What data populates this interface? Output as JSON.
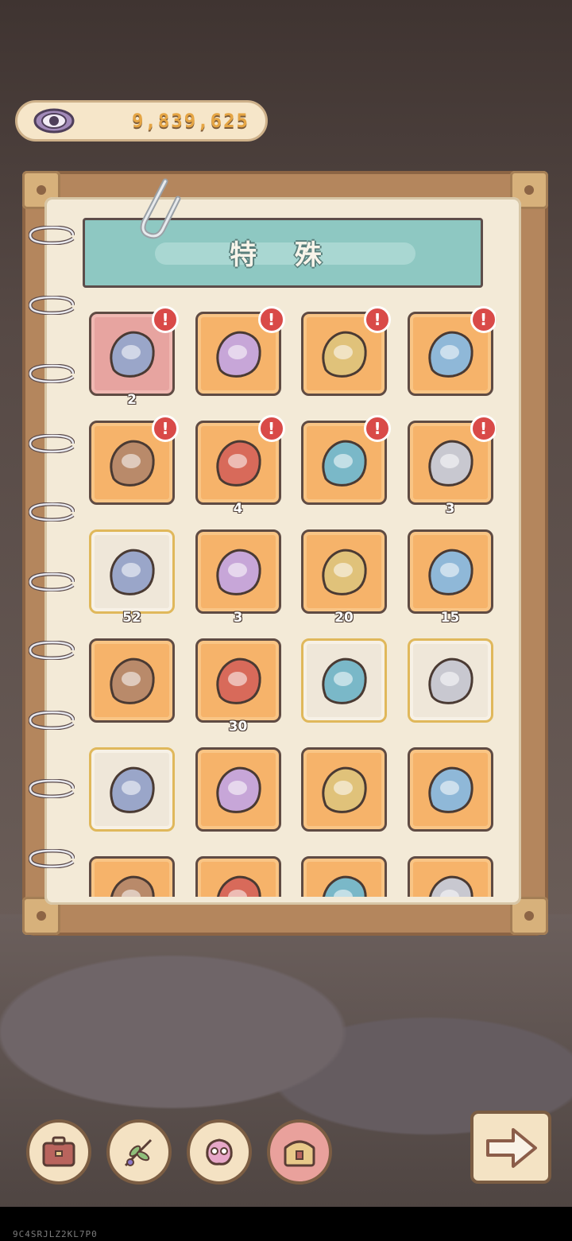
{
  "currency": {
    "icon": "eye-icon",
    "value": "9,839,625"
  },
  "page": {
    "title": "特 殊"
  },
  "items": [
    {
      "icon": "gem-pouch-icon",
      "style": "pink",
      "count": "2",
      "badge": true
    },
    {
      "icon": "gift-box-icon",
      "style": "orange",
      "count": "",
      "badge": true
    },
    {
      "icon": "treasure-chest-icon",
      "style": "orange",
      "count": "",
      "badge": true
    },
    {
      "icon": "ornate-pouch-icon",
      "style": "orange",
      "count": "",
      "badge": true
    },
    {
      "icon": "chest-level-1-icon",
      "style": "orange",
      "count": "",
      "badge": true
    },
    {
      "icon": "chest-level-2-icon",
      "style": "orange",
      "count": "4",
      "badge": true
    },
    {
      "icon": "specimen-jar-icon",
      "style": "orange",
      "count": "",
      "badge": true
    },
    {
      "icon": "fossil-stone-icon",
      "style": "orange",
      "count": "3",
      "badge": true
    },
    {
      "icon": "poop-icon",
      "style": "white",
      "count": "52",
      "badge": false
    },
    {
      "icon": "flame-mask-icon",
      "style": "orange",
      "count": "3",
      "badge": false
    },
    {
      "icon": "bracer-icon",
      "style": "orange",
      "count": "20",
      "badge": false
    },
    {
      "icon": "crystal-icon",
      "style": "orange",
      "count": "15",
      "badge": false
    },
    {
      "icon": "root-icon",
      "style": "orange",
      "count": "",
      "badge": false
    },
    {
      "icon": "driftwood-icon",
      "style": "orange",
      "count": "30",
      "badge": false
    },
    {
      "icon": "newspaper-icon",
      "style": "white",
      "count": "",
      "badge": false
    },
    {
      "icon": "tabloid-icon",
      "style": "white",
      "count": "",
      "badge": false
    },
    {
      "icon": "map-icon",
      "style": "white",
      "count": "",
      "badge": false
    },
    {
      "icon": "stone-tablets-icon",
      "style": "orange",
      "count": "",
      "badge": false
    },
    {
      "icon": "metal-parts-icon",
      "style": "orange",
      "count": "",
      "badge": false
    },
    {
      "icon": "spray-can-icon",
      "style": "orange",
      "count": "",
      "badge": false
    },
    {
      "icon": "dice-block-icon",
      "style": "orange",
      "count": "",
      "badge": false
    },
    {
      "icon": "stone-ruin-icon",
      "style": "orange",
      "count": "",
      "badge": false
    },
    {
      "icon": "spotted-leaf-icon",
      "style": "orange",
      "count": "",
      "badge": false
    },
    {
      "icon": "beetle-icon",
      "style": "orange",
      "count": "",
      "badge": false
    }
  ],
  "nav": [
    {
      "icon": "briefcase-icon",
      "active": false
    },
    {
      "icon": "herb-branch-icon",
      "active": false
    },
    {
      "icon": "creature-icon",
      "active": false
    },
    {
      "icon": "treasure-box-icon",
      "active": true
    }
  ],
  "next": {
    "icon": "arrow-right-icon"
  },
  "footer": {
    "code": "9C4SRJLZ2KL7P0"
  },
  "colors": {
    "orange_tile": "#f6b36a",
    "pink_tile": "#e7a4a0",
    "white_tile": "#efe7d9",
    "header": "#8ec8c2",
    "badge": "#d94a48"
  }
}
